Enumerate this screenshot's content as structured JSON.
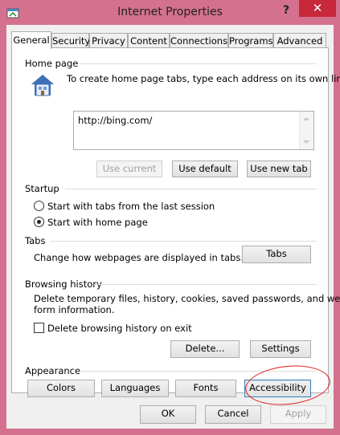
{
  "window": {
    "title": "Internet Properties",
    "help_glyph": "?",
    "close_glyph": "✕",
    "colors": {
      "frame": "#d4718f",
      "close": "#c7283a",
      "annotation": "#e2191e"
    }
  },
  "tabs": [
    {
      "label": "General",
      "active": true
    },
    {
      "label": "Security"
    },
    {
      "label": "Privacy"
    },
    {
      "label": "Content"
    },
    {
      "label": "Connections"
    },
    {
      "label": "Programs"
    },
    {
      "label": "Advanced"
    }
  ],
  "home_page": {
    "group_label": "Home page",
    "instruction": "To create home page tabs, type each address on its own line.",
    "url_value": "http://bing.com/",
    "use_current": "Use current",
    "use_default": "Use default",
    "use_new_tab": "Use new tab"
  },
  "startup": {
    "group_label": "Startup",
    "option_tabs": "Start with tabs from the last session",
    "option_home": "Start with home page",
    "selected": "Start with home page"
  },
  "tabs_group": {
    "group_label": "Tabs",
    "description": "Change how webpages are displayed in tabs.",
    "button": "Tabs"
  },
  "history": {
    "group_label": "Browsing history",
    "description_line1": "Delete temporary files, history, cookies, saved passwords, and web",
    "description_line2": "form information.",
    "checkbox_label": "Delete browsing history on exit",
    "checkbox_checked": false,
    "delete_button": "Delete...",
    "settings_button": "Settings"
  },
  "appearance": {
    "group_label": "Appearance",
    "colors": "Colors",
    "languages": "Languages",
    "fonts": "Fonts",
    "accessibility": "Accessibility"
  },
  "footer": {
    "ok": "OK",
    "cancel": "Cancel",
    "apply": "Apply"
  }
}
